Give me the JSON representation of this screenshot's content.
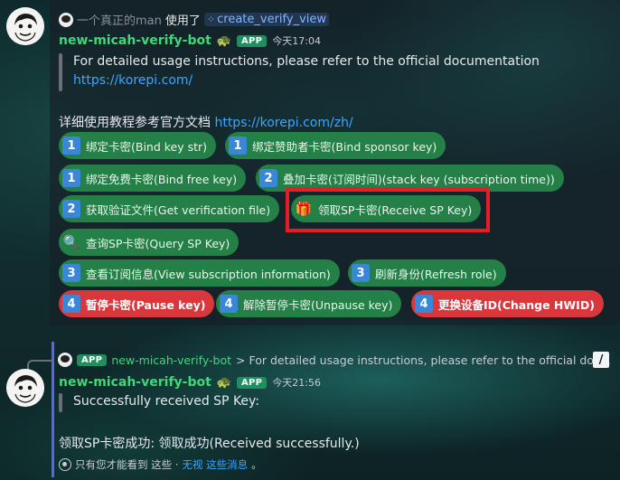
{
  "message1": {
    "reply": {
      "user": "一个真正的man",
      "used_text": "使用了",
      "command": "create_verify_view"
    },
    "bot_name": "new-micah-verify-bot",
    "app_tag": "APP",
    "time": "今天17:04",
    "quote_line1": "For detailed usage instructions, please refer to the official documentation",
    "quote_link": "https://korepi.com/",
    "body_prefix": "详细使用教程参考官方文档 ",
    "body_link": "https://korepi.com/zh/",
    "buttons": [
      {
        "icon": "1",
        "label": "绑定卡密(Bind key str)",
        "style": "green"
      },
      {
        "icon": "1",
        "label": "绑定赞助者卡密(Bind sponsor key)",
        "style": "green"
      },
      {
        "icon": "1",
        "label": "绑定免费卡密(Bind free key)",
        "style": "green"
      },
      {
        "icon": "2",
        "label": "叠加卡密(订阅时间)(stack key (subscription time))",
        "style": "green"
      },
      {
        "icon": "2",
        "label": "获取验证文件(Get verification file)",
        "style": "green"
      },
      {
        "icon": "gift-icon",
        "label": "领取SP卡密(Receive SP Key)",
        "style": "green"
      },
      {
        "icon": "magnifier-icon",
        "label": "查询SP卡密(Query SP Key)",
        "style": "green"
      },
      {
        "icon": "3",
        "label": "查看订阅信息(View subscription information)",
        "style": "green"
      },
      {
        "icon": "3",
        "label": "刷新身份(Refresh role)",
        "style": "green"
      },
      {
        "icon": "4",
        "label": "暂停卡密(Pause key)",
        "style": "red"
      },
      {
        "icon": "4",
        "label": "解除暂停卡密(Unpause key)",
        "style": "green"
      },
      {
        "icon": "4",
        "label": "更换设备ID(Change HWID)",
        "style": "red"
      }
    ]
  },
  "message2": {
    "reply": {
      "app_tag": "APP",
      "bot_name": "new-micah-verify-bot",
      "snippet": "> For detailed usage instructions, please refer to the official doc..."
    },
    "bot_name": "new-micah-verify-bot",
    "app_tag": "APP",
    "time": "今天21:56",
    "quote_line": "Successfully received SP Key:",
    "result_line": "领取SP卡密成功: 领取成功(Received successfully.)",
    "ephemeral": {
      "text": "只有您才能看到 这些 · ",
      "dismiss_label": "无视 这些消息",
      "suffix": "。"
    }
  },
  "colors": {
    "bot_name": "#42d67a",
    "button_green": "#248046",
    "button_red": "#da373c",
    "number_badge": "#3a87d8",
    "link": "#3ea6ff",
    "highlight_box": "#e51e25"
  }
}
